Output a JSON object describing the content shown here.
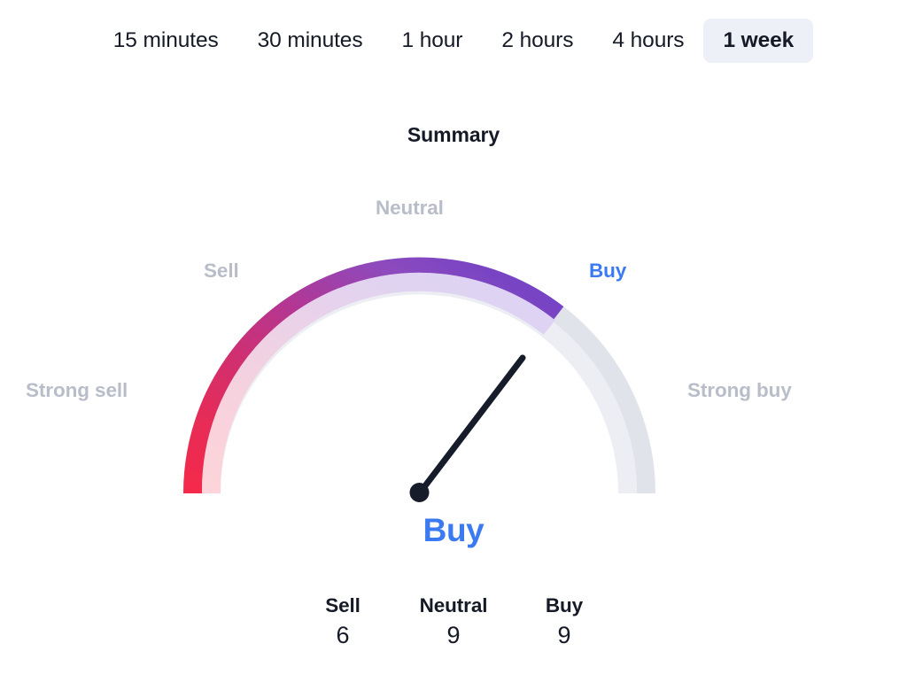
{
  "timeframes": {
    "tabs": [
      {
        "label": "15 minutes",
        "active": false
      },
      {
        "label": "30 minutes",
        "active": false
      },
      {
        "label": "1 hour",
        "active": false
      },
      {
        "label": "2 hours",
        "active": false
      },
      {
        "label": "4 hours",
        "active": false
      },
      {
        "label": "1 week",
        "active": true
      }
    ],
    "selected": "1 week"
  },
  "panel": {
    "title": "Summary",
    "verdict": "Buy",
    "verdict_color": "#3b7af0"
  },
  "gauge": {
    "zone_labels": {
      "strong_sell": "Strong sell",
      "sell": "Sell",
      "neutral": "Neutral",
      "buy": "Buy",
      "strong_buy": "Strong buy"
    },
    "active_zone": "buy",
    "label_color": "#b9bdc9",
    "active_label_color": "#3b7af0",
    "track_color": "#e1e3ea",
    "needle_color": "#171c2b",
    "gradient_stops": [
      "#f5294a",
      "#e12c5b",
      "#cf2f72",
      "#a93c9e",
      "#8b4bbf",
      "#6940c9"
    ]
  },
  "counts": {
    "columns": [
      {
        "label": "Sell",
        "value": "6"
      },
      {
        "label": "Neutral",
        "value": "9"
      },
      {
        "label": "Buy",
        "value": "9"
      }
    ]
  },
  "chart_data": {
    "type": "gauge",
    "title": "Summary",
    "categories": [
      "Strong sell",
      "Sell",
      "Neutral",
      "Buy",
      "Strong buy"
    ],
    "value_label": "Buy",
    "needle_fraction": 0.72,
    "filled_fraction": 0.82,
    "series": [
      {
        "name": "Sell",
        "values": [
          6
        ]
      },
      {
        "name": "Neutral",
        "values": [
          9
        ]
      },
      {
        "name": "Buy",
        "values": [
          9
        ]
      }
    ],
    "xlabel": "",
    "ylabel": "",
    "legend": "none",
    "grid": false
  }
}
